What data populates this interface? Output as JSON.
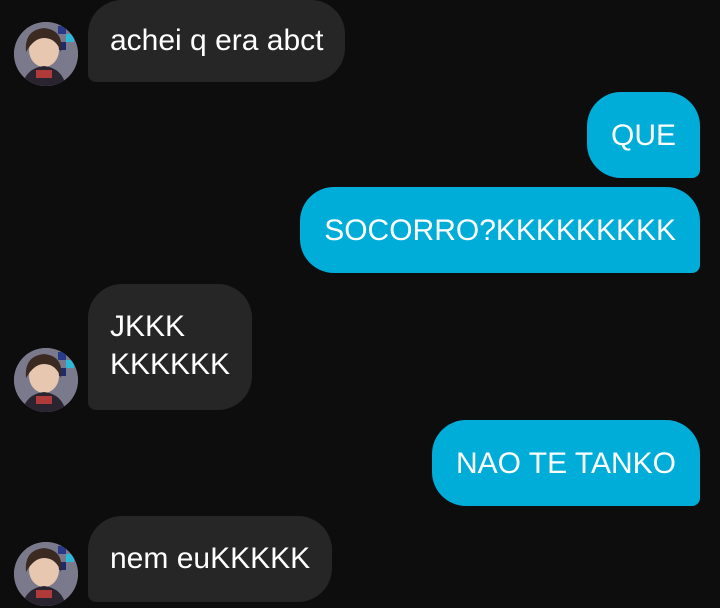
{
  "chat": {
    "messages": [
      {
        "sender": "contact",
        "lines": [
          "achei q era abct"
        ]
      },
      {
        "sender": "me",
        "lines": [
          "QUE"
        ]
      },
      {
        "sender": "me",
        "lines": [
          "SOCORRO?KKKKKKKKK"
        ]
      },
      {
        "sender": "contact",
        "lines": [
          "JKKK",
          "KKKKKK"
        ]
      },
      {
        "sender": "me",
        "lines": [
          "NAO TE TANKO"
        ]
      },
      {
        "sender": "contact",
        "lines": [
          "nem euKKKKK"
        ]
      }
    ]
  },
  "colors": {
    "background": "#0d0d0d",
    "incoming_bubble": "#262626",
    "outgoing_bubble": "#00acd8",
    "text": "#ffffff"
  }
}
